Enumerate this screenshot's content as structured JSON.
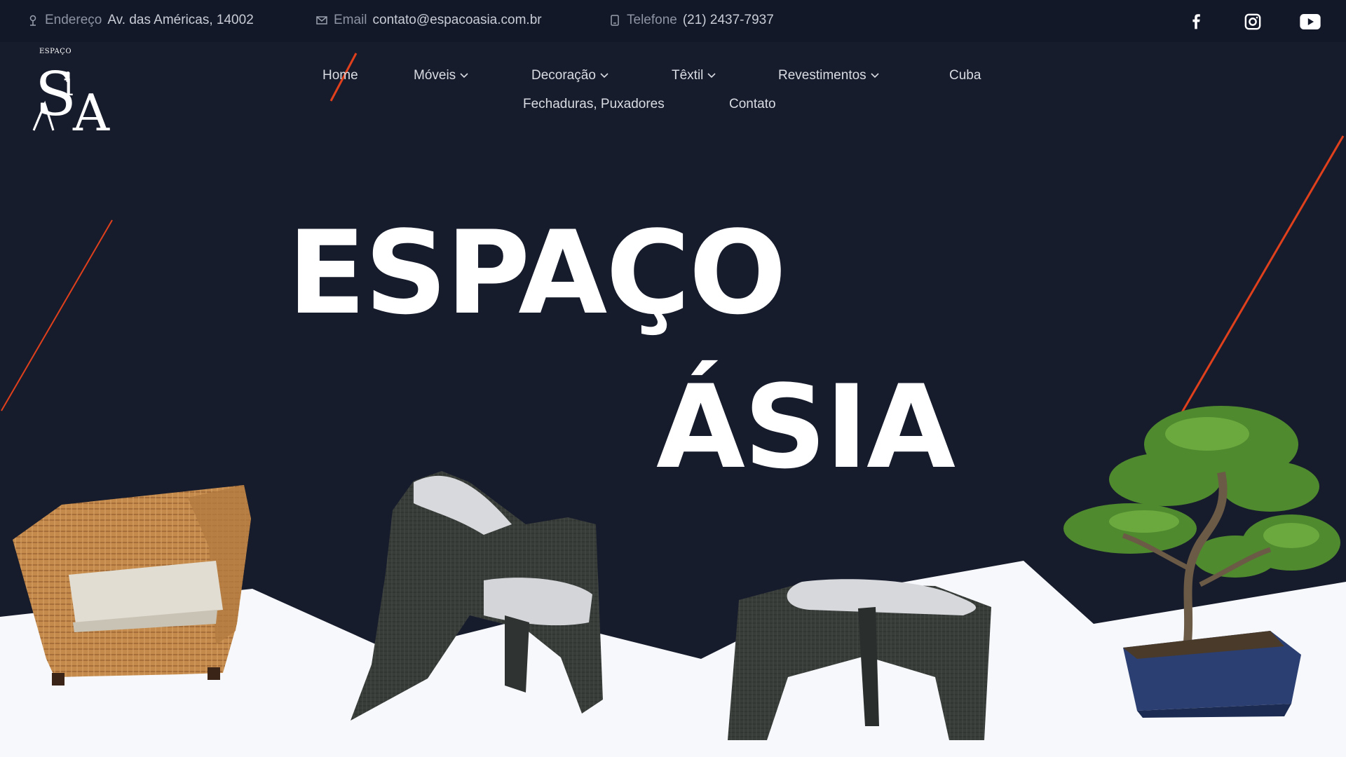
{
  "topbar": {
    "address_label": "Endereço",
    "address_value": "Av. das Américas, 14002",
    "email_label": "Email",
    "email_value": "contato@espacoasia.com.br",
    "phone_label": "Telefone",
    "phone_value": "(21) 2437-7937",
    "social": [
      "facebook-icon",
      "instagram-icon",
      "youtube-icon"
    ]
  },
  "logo": {
    "small": "ESPAÇO",
    "big_top": "S",
    "big_bottom": "A",
    "i_letter": "i"
  },
  "nav": {
    "items": [
      {
        "label": "Home",
        "active": true
      },
      {
        "label": "Móveis",
        "dropdown": true
      },
      {
        "label": "Decoração",
        "dropdown": true
      },
      {
        "label": "Têxtil",
        "dropdown": true
      },
      {
        "label": "Revestimentos",
        "dropdown": true
      },
      {
        "label": "Cuba"
      },
      {
        "label": "Fechaduras, Puxadores"
      },
      {
        "label": "Contato"
      }
    ]
  },
  "hero": {
    "line1": "ESPAÇO",
    "line2": "ÁSIA"
  },
  "colors": {
    "background": "#171c2c",
    "topbar": "#131828",
    "accent": "#e0401c",
    "text": "#ffffff"
  }
}
